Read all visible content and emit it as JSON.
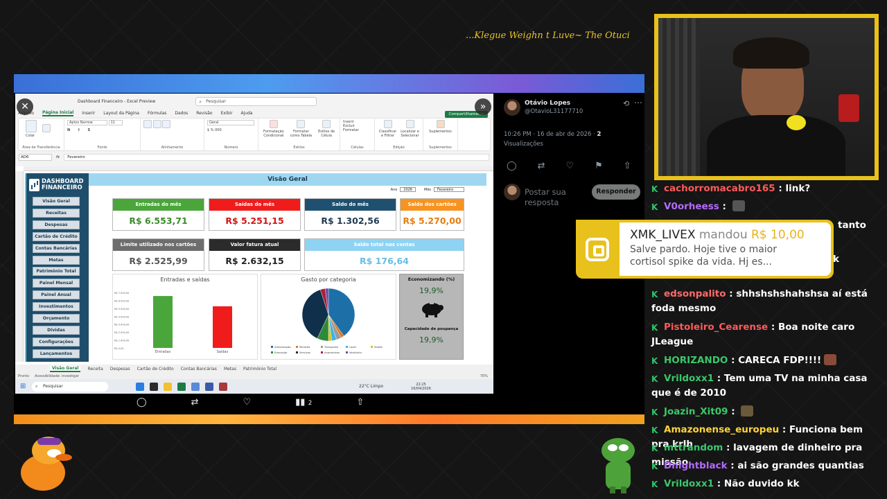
{
  "ticker": "...Klegue Weighn t Luve~ The Otuci",
  "excel": {
    "app_title": "Dashboard Financeiro  -  Excel Preview",
    "search_placeholder": "Pesquisar",
    "share": "Compartilhamento",
    "menu": [
      "Arquivo",
      "Página Inicial",
      "Inserir",
      "Layout da Página",
      "Fórmulas",
      "Dados",
      "Revisão",
      "Exibir",
      "Ajuda"
    ],
    "ribbon": {
      "clipboard": "Área de Transferência",
      "paste": "Colar",
      "font": "Fonte",
      "font_name": "Aptos Narrow",
      "font_size": "11",
      "alignment": "Alinhamento",
      "number": "Número",
      "number_format": "Geral",
      "styles": "Estilos",
      "cond_format": "Formatação Condicional",
      "format_table": "Formatar como Tabela",
      "cell_styles": "Estilos de Célula",
      "cells": "Células",
      "insert": "Inserir",
      "delete": "Excluir",
      "format": "Formatar",
      "editing": "Edição",
      "sort_filter": "Classificar e Filtrar",
      "find_select": "Localizar e Selecionar",
      "addins": "Suplementos",
      "addins_btn": "Suplementos"
    },
    "name_box": "AD6",
    "formula": "Fevereiro",
    "dashboard": {
      "logo_line1": "DASHBOARD",
      "logo_line2": "FINANCEIRO",
      "nav": [
        "Visão Geral",
        "Receitas",
        "Despesas",
        "Cartão de Crédito",
        "Contas Bancárias",
        "Metas",
        "Patrimônio Total",
        "Painel Mensal",
        "Painel Anual",
        "Investimentos",
        "Orçamento",
        "Dívidas",
        "Configurações",
        "Lançamentos"
      ],
      "title": "Visão Geral",
      "filter_year_label": "Ano",
      "filter_year": "2026",
      "filter_month_label": "Mês",
      "filter_month": "Fevereiro",
      "cards": [
        {
          "label": "Entradas do mês",
          "value": "R$ 6.553,71",
          "head_color": "#4aa63a",
          "value_color": "#3a8c2b"
        },
        {
          "label": "Saídas do mês",
          "value": "R$ 5.251,15",
          "head_color": "#f01c1c",
          "value_color": "#d01515"
        },
        {
          "label": "Saldo do mês",
          "value": "R$ 1.302,56",
          "head_color": "#1f5070",
          "value_color": "#1f3b52"
        },
        {
          "label": "Saldo dos cartões",
          "value": "R$ 5.270,00",
          "head_color": "#f79321",
          "value_color": "#e67e12"
        },
        {
          "label": "Limite utilizado nos cartões",
          "value": "R$ 2.525,99",
          "head_color": "#6d6d6d",
          "value_color": "#555555"
        },
        {
          "label": "Valor fatura atual",
          "value": "R$ 2.632,15",
          "head_color": "#2b2b2b",
          "value_color": "#222222"
        },
        {
          "label": "Saldo total nas contas",
          "value": "R$ 176,64",
          "head_color": "#8fd3f3",
          "value_color": "#66bde8"
        }
      ],
      "economy_title": "Economizando (%)",
      "economy_value": "19,9%",
      "savings_title": "Capacidade de poupança",
      "savings_value": "19,9%"
    },
    "chart_entries_exits": {
      "type": "bar",
      "title": "Entradas e saídas",
      "categories": [
        "Entradas",
        "Saídas"
      ],
      "values": [
        6553.71,
        5251.15
      ],
      "colors": [
        "#4aa63a",
        "#f01c1c"
      ],
      "yticks": [
        "R$ 7.000,00",
        "R$ 6.000,00",
        "R$ 5.000,00",
        "R$ 4.000,00",
        "R$ 3.000,00",
        "R$ 2.000,00",
        "R$ 1.000,00",
        "R$ 0,00"
      ],
      "ylim": [
        0,
        7000
      ]
    },
    "chart_category": {
      "type": "pie",
      "title": "Gasto por categoria",
      "labels": [
        "Alimentação",
        "Moradia",
        "Transporte",
        "Lazer",
        "Saúde",
        "Educação",
        "Serviços",
        "Imprevistos",
        "Vestuário"
      ],
      "values": [
        40,
        2,
        3,
        3,
        2,
        7,
        38,
        3,
        2
      ],
      "colors": [
        "#1d6fa8",
        "#e07a1f",
        "#9a9a9a",
        "#3fb3e6",
        "#d9c21b",
        "#2d8a3a",
        "#0f2f4a",
        "#a8203a",
        "#6d4aa8"
      ]
    },
    "sheets": [
      "Visão Geral",
      "Receita",
      "Despesas",
      "Cartão de Crédito",
      "Contas Bancárias",
      "Metas",
      "Patrimônio Total"
    ],
    "status_ready": "Pronto",
    "status_access": "Acessibilidade: investigar",
    "zoom": "70%",
    "taskbar_search": "Pesquisar",
    "weather": "22°C  Limpo",
    "time": "22:25",
    "date": "16/04/2026"
  },
  "tweet": {
    "name": "Otávio Lopes",
    "handle": "@OtavioL31177710",
    "timestamp": "10:26 PM · 16 de abr de 2026 · ",
    "views_count": "2",
    "views_label": "Visualizações",
    "reply_placeholder": "Postar sua resposta",
    "reply_button": "Responder",
    "bottom_count": "2"
  },
  "donation": {
    "user": "XMK_LIVEX",
    "verb": "mandou",
    "amount": "R$ 10,00",
    "message": "Salve pardo. Hoje tive o maior cortisol spike da vida. Hj es..."
  },
  "chat": [
    {
      "user": "cachorromacabro165",
      "text": "link?",
      "color": "#ff5a5a",
      "top": 0
    },
    {
      "user": "V0orheess",
      "text": "",
      "color": "#b46bff",
      "top": 26,
      "emote": "#555"
    },
    {
      "user": "edsonpalito",
      "text": "shhshshshahshsa aí está foda mesmo",
      "color": "#ff6a6a",
      "top": 152
    },
    {
      "user": "Pistoleiro_Cearense",
      "text": "Boa noite caro JLeague",
      "color": "#ff5a5a",
      "top": 200
    },
    {
      "user": "HORIZANDO",
      "text": "CARECA FDP!!!!",
      "color": "#3ac86b",
      "top": 248,
      "emote": "#8a4a3a"
    },
    {
      "user": "Vrildoxx1",
      "text": "Tem uma TV na minha casa que é de 2010",
      "color": "#3ac86b",
      "top": 274
    },
    {
      "user": "Joazin_Xit09",
      "text": "",
      "color": "#3ac86b",
      "top": 322,
      "emote": "#6a5a3a"
    },
    {
      "user": "Amazonense_europeu",
      "text": "Funciona bem pra krlh",
      "color": "#ffd43a",
      "top": 348
    },
    {
      "user": "mttrandom",
      "text": "lavagem de dinheiro pra missão",
      "color": "#3ac86b",
      "top": 374
    },
    {
      "user": "Dnightblack",
      "text": "ai são grandes quantias",
      "color": "#b46bff",
      "top": 400
    },
    {
      "user": "Vrildoxx1",
      "text": "Não duvido kk",
      "color": "#3ac86b",
      "top": 426
    }
  ],
  "chat_partial": {
    "tanto": "tanto",
    "k": "k"
  }
}
